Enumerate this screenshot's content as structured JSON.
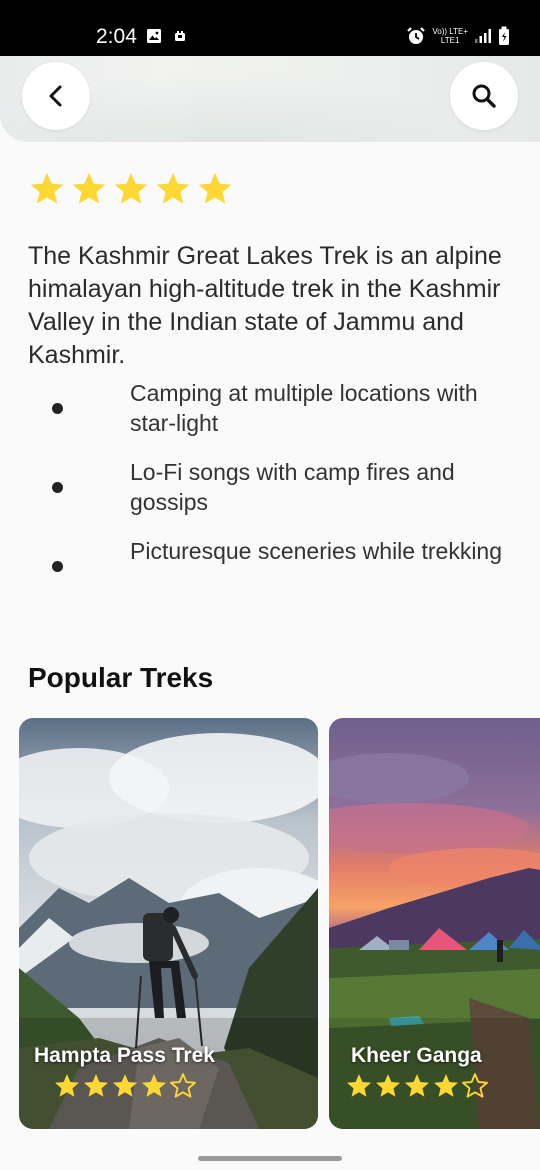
{
  "status_bar": {
    "time": "2:04",
    "left_icons": [
      "gallery-icon",
      "notification-icon"
    ],
    "right_icons": [
      "alarm-icon",
      "volte-icon",
      "signal-icon",
      "battery-icon"
    ],
    "net_line1": "Vo)) LTE+",
    "net_line2": "LTE1"
  },
  "header": {
    "back_icon": "chevron-left-icon",
    "search_icon": "search-icon"
  },
  "trek": {
    "rating": 5,
    "description": "The Kashmir Great Lakes Trek is an alpine himalayan high-altitude trek in the Kashmir Valley in the Indian state of Jammu and Kashmir.",
    "features": [
      "Camping at multiple locations with star-light",
      "Lo-Fi songs with camp fires and gossips",
      "Picturesque sceneries while trekking"
    ]
  },
  "popular": {
    "title": "Popular Treks",
    "cards": [
      {
        "name": "Hampta Pass Trek",
        "rating": 4,
        "max_rating": 5
      },
      {
        "name": "Kheer Ganga",
        "rating": 4,
        "max_rating": 5
      }
    ]
  },
  "colors": {
    "star": "#FDD835",
    "background": "#FAFAFA",
    "status_bar": "#000000"
  }
}
